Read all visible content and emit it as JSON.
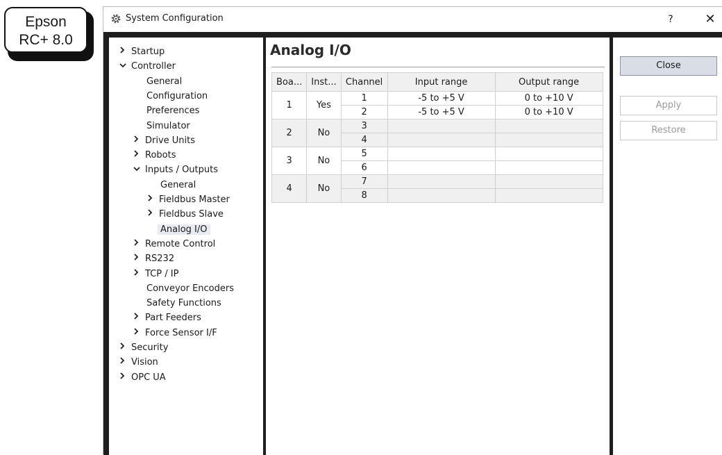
{
  "badge": {
    "line1": "Epson",
    "line2": "RC+ 8.0"
  },
  "window": {
    "title": "System Configuration",
    "title_icon": "gear-icon",
    "help_label": "?",
    "close_label": "✕"
  },
  "tree": [
    {
      "label": "Startup",
      "level": 0,
      "chevron": "›"
    },
    {
      "label": "Controller",
      "level": 0,
      "chevron": "⌄"
    },
    {
      "label": "General",
      "level": 1,
      "chevron": ""
    },
    {
      "label": "Configuration",
      "level": 1,
      "chevron": ""
    },
    {
      "label": "Preferences",
      "level": 1,
      "chevron": ""
    },
    {
      "label": "Simulator",
      "level": 1,
      "chevron": ""
    },
    {
      "label": "Drive Units",
      "level": 1,
      "chevron": "›"
    },
    {
      "label": "Robots",
      "level": 1,
      "chevron": "›"
    },
    {
      "label": "Inputs / Outputs",
      "level": 1,
      "chevron": "⌄"
    },
    {
      "label": "General",
      "level": 2,
      "chevron": ""
    },
    {
      "label": "Fieldbus Master",
      "level": 2,
      "chevron": "›"
    },
    {
      "label": "Fieldbus Slave",
      "level": 2,
      "chevron": "›"
    },
    {
      "label": "Analog I/O",
      "level": 2,
      "chevron": "",
      "selected": true
    },
    {
      "label": "Remote Control",
      "level": 1,
      "chevron": "›"
    },
    {
      "label": "RS232",
      "level": 1,
      "chevron": "›"
    },
    {
      "label": "TCP / IP",
      "level": 1,
      "chevron": "›"
    },
    {
      "label": "Conveyor Encoders",
      "level": 1,
      "chevron": ""
    },
    {
      "label": "Safety Functions",
      "level": 1,
      "chevron": ""
    },
    {
      "label": "Part Feeders",
      "level": 1,
      "chevron": "›"
    },
    {
      "label": "Force Sensor I/F",
      "level": 1,
      "chevron": "›"
    },
    {
      "label": "Security",
      "level": 0,
      "chevron": "›"
    },
    {
      "label": "Vision",
      "level": 0,
      "chevron": "›"
    },
    {
      "label": "OPC UA",
      "level": 0,
      "chevron": "›"
    }
  ],
  "content": {
    "title": "Analog I/O",
    "columns": [
      "Boa...",
      "Inst...",
      "Channel",
      "Input range",
      "Output range"
    ],
    "boards": [
      {
        "board": "1",
        "installed": "Yes",
        "channels": [
          {
            "channel": "1",
            "input": "-5 to +5 V",
            "output": "0 to +10 V"
          },
          {
            "channel": "2",
            "input": "-5 to +5 V",
            "output": "0 to +10 V"
          }
        ]
      },
      {
        "board": "2",
        "installed": "No",
        "channels": [
          {
            "channel": "3",
            "input": "",
            "output": ""
          },
          {
            "channel": "4",
            "input": "",
            "output": ""
          }
        ]
      },
      {
        "board": "3",
        "installed": "No",
        "channels": [
          {
            "channel": "5",
            "input": "",
            "output": ""
          },
          {
            "channel": "6",
            "input": "",
            "output": ""
          }
        ]
      },
      {
        "board": "4",
        "installed": "No",
        "channels": [
          {
            "channel": "7",
            "input": "",
            "output": ""
          },
          {
            "channel": "8",
            "input": "",
            "output": ""
          }
        ]
      }
    ]
  },
  "buttons": {
    "close": "Close",
    "apply": "Apply",
    "restore": "Restore"
  }
}
